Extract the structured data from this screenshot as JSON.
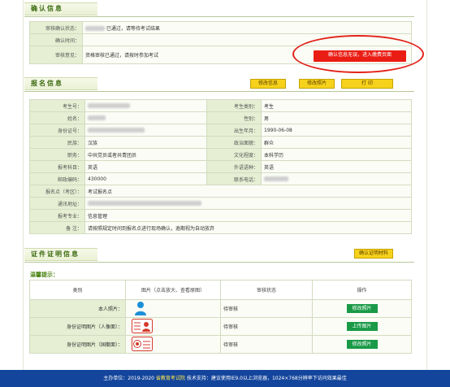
{
  "confirm_section": {
    "title": "确认信息",
    "rows": [
      {
        "label": "审核确认状态：",
        "value": "已通过，请等待考试结果"
      },
      {
        "label": "确认时间：",
        "value": ""
      },
      {
        "label": "审核意见：",
        "value": "资格审核已通过，请按时参加考试"
      }
    ],
    "note_button": "确认信息无误，进入缴费页面"
  },
  "signup_section": {
    "title": "报名信息",
    "buttons": [
      "修改信息",
      "修改照片",
      "打 印"
    ],
    "left_rows": [
      {
        "label": "考生号：",
        "value": ""
      },
      {
        "label": "姓名：",
        "value": ""
      },
      {
        "label": "身份证号：",
        "value": ""
      },
      {
        "label": "民族：",
        "value": "汉族"
      },
      {
        "label": "职务：",
        "value": "中共党员或者共青团员"
      },
      {
        "label": "报考科目：",
        "value": "英语"
      },
      {
        "label": "邮政编码：",
        "value": "430000"
      }
    ],
    "right_rows": [
      {
        "label": "考生类别：",
        "value": "考生"
      },
      {
        "label": "性别：",
        "value": "男"
      },
      {
        "label": "出生年月：",
        "value": "1990-06-08"
      },
      {
        "label": "政治面貌：",
        "value": "群众"
      },
      {
        "label": "文化程度：",
        "value": "本科学历"
      },
      {
        "label": "外语语种：",
        "value": "英语"
      },
      {
        "label": "联系电话：",
        "value": ""
      }
    ],
    "full_rows": [
      {
        "label": "报名点（考区）：",
        "value": "考试报名点"
      },
      {
        "label": "通讯地址：",
        "value": ""
      },
      {
        "label": "报考专业：",
        "value": "信息管理"
      },
      {
        "label": "备 注：",
        "value": "请按照规定时间到报名点进行现场确认，逾期视为自动放弃"
      }
    ]
  },
  "cert_section": {
    "title": "证件证明信息",
    "action_button": "确认证明材料",
    "hint": "温馨提示：",
    "headers": [
      "类别",
      "图片（点击放大、查看原图）",
      "审核状态",
      "操作"
    ],
    "rows": [
      {
        "label": "本人照片：",
        "status": "待审核",
        "action": "修改照片",
        "icon": "person-icon"
      },
      {
        "label": "身份证明图片（人像面）：",
        "status": "待审核",
        "action": "上传图片",
        "icon": "id-card-front-icon"
      },
      {
        "label": "身份证明图片（国徽面）：",
        "status": "待审核",
        "action": "修改照片",
        "icon": "id-card-back-icon"
      }
    ]
  },
  "footer": {
    "left": "主办单位：2019-2020",
    "highlight": "省教育考试院",
    "right": "技术支持：建议使用IE9.0以上浏览器，1024×768分辨率下访问效果最佳"
  },
  "colors": {
    "accent": "#f7d21c",
    "danger": "#ea1d14",
    "ok": "#1a9a47",
    "footer": "#14459c"
  }
}
